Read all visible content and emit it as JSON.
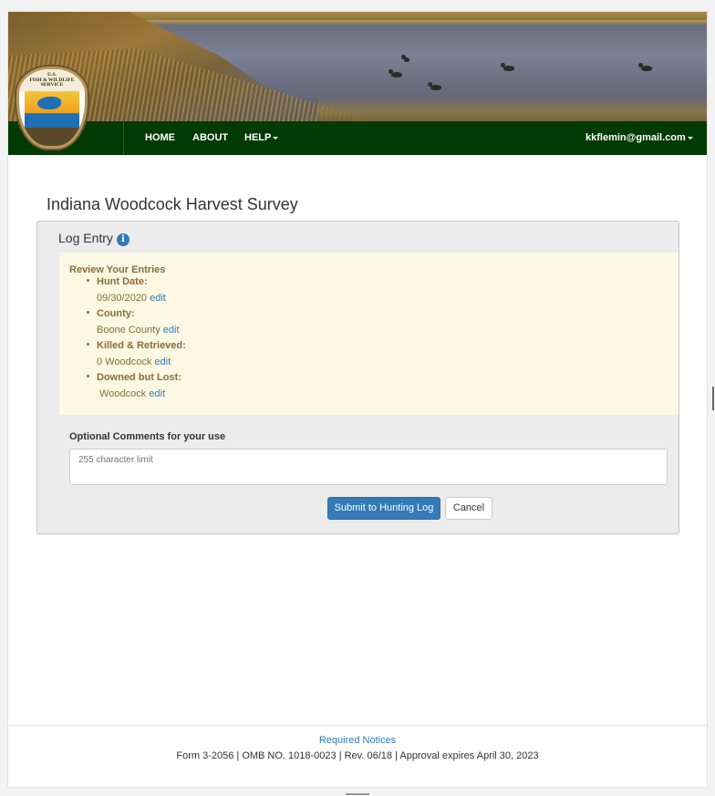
{
  "header": {
    "seal_lines": [
      "U.S.",
      "FISH & WILDLIFE",
      "SERVICE"
    ],
    "nav": [
      {
        "label": "HOME"
      },
      {
        "label": "ABOUT"
      },
      {
        "label": "HELP"
      }
    ],
    "user_email": "kkflemin@gmail.com"
  },
  "page": {
    "title": "Indiana Woodcock Harvest Survey"
  },
  "panel": {
    "heading": "Log Entry",
    "info_icon": "info-icon",
    "review": {
      "title": "Review Your Entries",
      "items": [
        {
          "label": "Hunt Date:",
          "value": "09/30/2020",
          "edit": "edit"
        },
        {
          "label": "County:",
          "value": "Boone County",
          "edit": "edit"
        },
        {
          "label": "Killed & Retrieved:",
          "value": "0 Woodcock",
          "edit": "edit"
        },
        {
          "label": "Downed but Lost:",
          "value": " Woodcock",
          "edit": "edit"
        }
      ]
    },
    "comments": {
      "label": "Optional Comments for your use",
      "placeholder": "255 character limit",
      "value": ""
    },
    "submit_label": "Submit to Hunting Log",
    "cancel_label": "Cancel"
  },
  "footer": {
    "notices_link": "Required Notices",
    "form_info": "Form 3-2056 | OMB NO. 1018-0023 | Rev. 06/18 | Approval expires April 30, 2023"
  },
  "colors": {
    "nav_bg": "#013a03",
    "primary": "#337ab7",
    "review_bg": "#fcf8e3",
    "review_text": "#8a6d3b"
  }
}
